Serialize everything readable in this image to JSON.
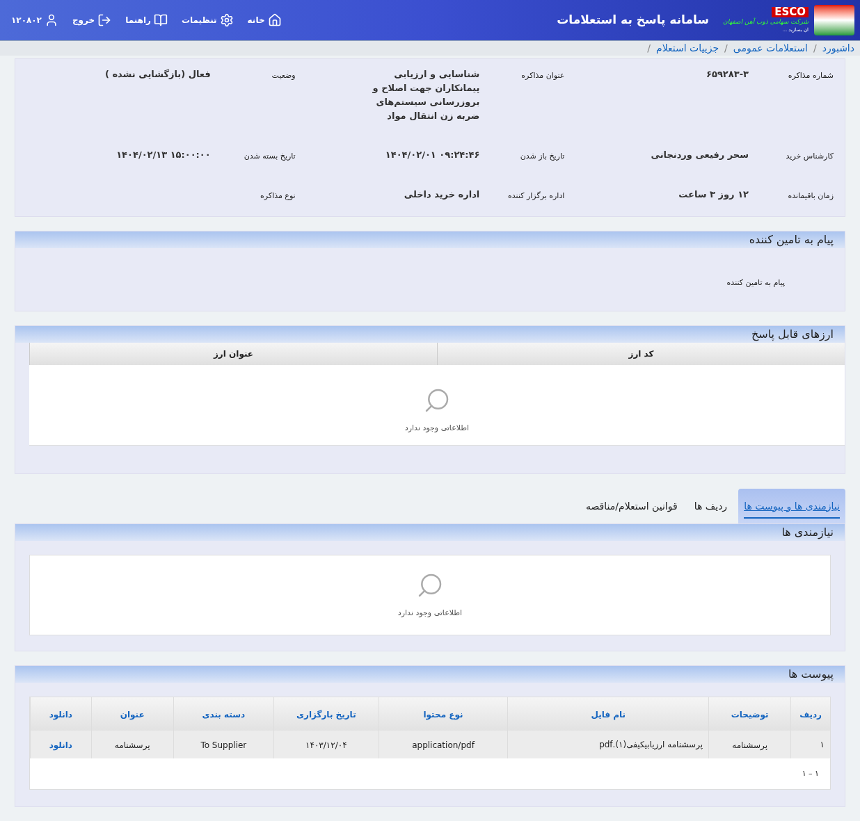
{
  "header": {
    "logo_text": "ESCO",
    "company": "شرکت سهامی ذوب آهن اصفهان",
    "slogan": "ان بسازید ...",
    "title": "سامانه پاسخ به استعلامات",
    "nav": [
      {
        "kind": "home",
        "label": "خانه"
      },
      {
        "kind": "settings",
        "label": "تنظیمات"
      },
      {
        "kind": "guide",
        "label": "راهنما"
      },
      {
        "kind": "logout",
        "label": "خروج"
      },
      {
        "kind": "user",
        "label": "۱۲۰۸۰۲"
      }
    ]
  },
  "breadcrumb": [
    "داشبورد",
    "استعلامات عمومی",
    "جزییات استعلام"
  ],
  "breadcrumb_separator": "/",
  "info": [
    {
      "label": "شماره مذاکره",
      "value": "۶۵۹۲۸۳-۳"
    },
    {
      "label": "عنوان مذاکره",
      "value": "شناسایی و ارزیابی پیمانکاران جهت اصلاح و بروزرسانی سیستم‌های ضربه زن انتقال مواد"
    },
    {
      "label": "وضعیت",
      "value": "فعال (بازگشایی نشده )"
    },
    {
      "label": "کارشناس خرید",
      "value": "سحر رفیعی وردنجانی"
    },
    {
      "label": "تاریخ باز شدن",
      "value": "۰۹:۲۴:۴۶ ۱۴۰۴/۰۲/۰۱"
    },
    {
      "label": "تاریخ بسته شدن",
      "value": "۱۵:۰۰:۰۰ ۱۴۰۴/۰۲/۱۳"
    },
    {
      "label": "زمان باقیمانده",
      "value": "۱۲ روز ۳ ساعت"
    },
    {
      "label": "اداره برگزار کننده",
      "value": "اداره خرید داخلی"
    },
    {
      "label": "نوع مذاکره"
    }
  ],
  "supplier_message": {
    "title": "پیام به تامین کننده",
    "label": "پیام به تامین کننده"
  },
  "currencies": {
    "title": "ارزهای قابل پاسخ",
    "columns": [
      "کد ارز",
      "عنوان ارز"
    ],
    "empty": "اطلاعاتی وجود ندارد"
  },
  "tabs": [
    {
      "label": "نیازمندی ها و پیوست ها",
      "selected": true
    },
    {
      "label": "ردیف ها",
      "selected": false
    },
    {
      "label": "قوانین استعلام/مناقصه",
      "selected": false
    }
  ],
  "requirements": {
    "title": "نیازمندی ها",
    "empty": "اطلاعاتی وجود ندارد"
  },
  "attachments": {
    "title": "پیوست ها",
    "columns": [
      "ردیف",
      "توضیحات",
      "نام فایل",
      "نوع محتوا",
      "تاریخ بارگزاری",
      "دسته بندی",
      "عنوان",
      "دانلود"
    ],
    "rows": [
      [
        "۱",
        "پرسشنامه",
        "پرسشنامه ارزیابیکیفی(۱).pdf",
        "application/pdf",
        "۱۴۰۳/۱۲/۰۴",
        "To Supplier",
        "پرسشنامه",
        "دانلود"
      ]
    ],
    "pagination": "۱ – ۱"
  }
}
